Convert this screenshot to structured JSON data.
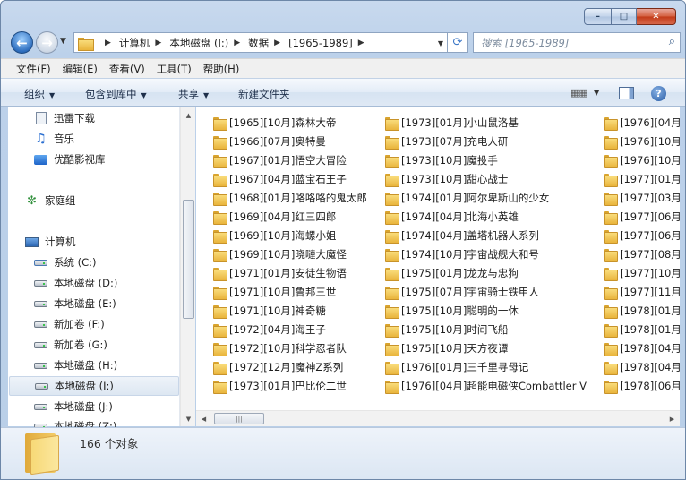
{
  "window": {
    "caption": {
      "minimize": "–",
      "maximize": "□",
      "close": "✕"
    }
  },
  "nav": {
    "breadcrumbs": [
      "计算机",
      "本地磁盘 (I:)",
      "数据",
      "[1965-1989]"
    ],
    "search_placeholder": "搜索 [1965-1989]",
    "refresh_icon": "⟳",
    "search_icon": "⌕"
  },
  "menu": [
    "文件(F)",
    "编辑(E)",
    "查看(V)",
    "工具(T)",
    "帮助(H)"
  ],
  "toolbar": {
    "organize": "组织",
    "include_library": "包含到库中",
    "share": "共享",
    "new_folder": "新建文件夹",
    "help": "?"
  },
  "sidebar": {
    "items": [
      {
        "label": "迅雷下载",
        "icon": "download-icon"
      },
      {
        "label": "音乐",
        "icon": "music-icon"
      },
      {
        "label": "优酷影视库",
        "icon": "video-library-icon"
      },
      {
        "label": "家庭组",
        "icon": "homegroup-icon"
      },
      {
        "label": "计算机",
        "icon": "computer-icon"
      },
      {
        "label": "系统 (C:)",
        "icon": "system-drive-icon"
      },
      {
        "label": "本地磁盘 (D:)",
        "icon": "drive-icon"
      },
      {
        "label": "本地磁盘 (E:)",
        "icon": "drive-icon"
      },
      {
        "label": "新加卷 (F:)",
        "icon": "drive-icon"
      },
      {
        "label": "新加卷 (G:)",
        "icon": "drive-icon"
      },
      {
        "label": "本地磁盘 (H:)",
        "icon": "drive-icon"
      },
      {
        "label": "本地磁盘 (I:)",
        "icon": "drive-icon",
        "selected": true
      },
      {
        "label": "本地磁盘 (J:)",
        "icon": "drive-icon"
      },
      {
        "label": "本地磁盘 (Z:)",
        "icon": "drive-icon"
      }
    ]
  },
  "files": {
    "col1": [
      "[1965][10月]森林大帝",
      "[1966][07月]奥特曼",
      "[1967][01月]悟空大冒险",
      "[1967][04月]蓝宝石王子",
      "[1968][01月]咯咯咯的鬼太郎",
      "[1969][04月]红三四郎",
      "[1969][10月]海螺小姐",
      "[1969][10月]晓嗹大魔怪",
      "[1971][01月]安徒生物语",
      "[1971][10月]鲁邦三世",
      "[1971][10月]神奇糖",
      "[1972][04月]海王子",
      "[1972][10月]科学忍者队",
      "[1972][12月]魔神Z系列",
      "[1973][01月]巴比伦二世"
    ],
    "col2": [
      "[1973][01月]小山鼠洛基",
      "[1973][07月]充电人研",
      "[1973][10月]魔投手",
      "[1973][10月]甜心战士",
      "[1974][01月]阿尔卑斯山的少女",
      "[1974][04月]北海小英雄",
      "[1974][04月]盖塔机器人系列",
      "[1974][10月]宇宙战舰大和号",
      "[1975][01月]龙龙与忠狗",
      "[1975][07月]宇宙骑士铁甲人",
      "[1975][10月]聪明的一休",
      "[1975][10月]时间飞船",
      "[1975][10月]天方夜谭",
      "[1976][01月]三千里寻母记",
      "[1976][04月]超能电磁侠Combattler V"
    ],
    "col3": [
      "[1976][04月",
      "[1976][10月",
      "[1976][10月",
      "[1977][01月",
      "[1977][03月",
      "[1977][06月",
      "[1977][06月",
      "[1977][08月",
      "[1977][10月",
      "[1977][11月",
      "[1978][01月",
      "[1978][01月",
      "[1978][04月",
      "[1978][04月",
      "[1978][06月"
    ]
  },
  "status": {
    "count": "166 个对象"
  }
}
